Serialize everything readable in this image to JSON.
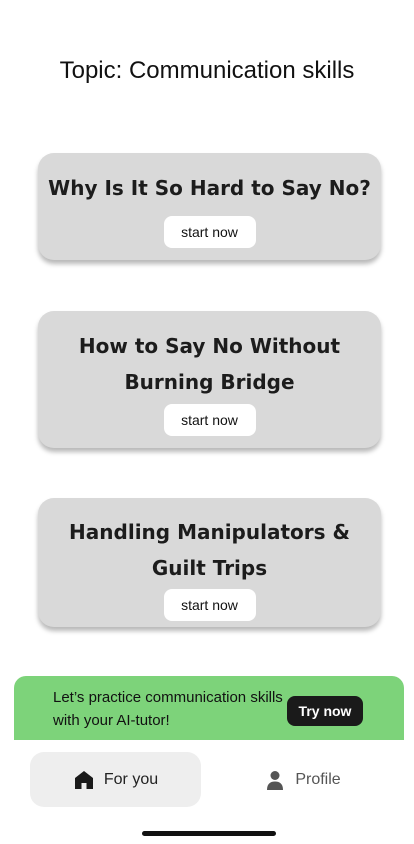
{
  "header": {
    "title": "Topic: Communication skills"
  },
  "lessons": [
    {
      "title": "Why Is It So Hard to Say No?",
      "button_label": "start now"
    },
    {
      "title": "How to Say No Without Burning Bridge",
      "button_label": "start now"
    },
    {
      "title": "Handling Manipulators & Guilt Trips",
      "button_label": "start now"
    }
  ],
  "promo": {
    "text": "Let’s practice communication skills with your AI-tutor!",
    "button_label": "Try now",
    "background_color": "#7dd37a"
  },
  "bottom_nav": {
    "items": [
      {
        "label": "For you",
        "icon": "home-icon",
        "active": true
      },
      {
        "label": "Profile",
        "icon": "person-icon",
        "active": false
      }
    ]
  }
}
